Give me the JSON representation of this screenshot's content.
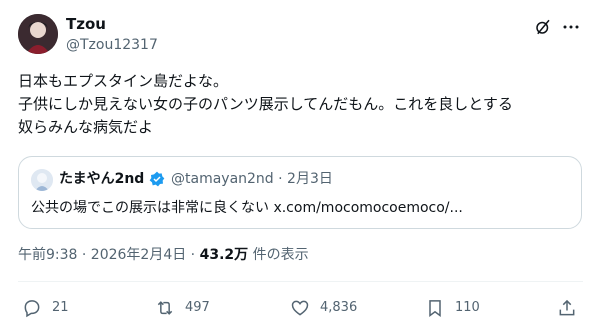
{
  "author": {
    "name": "Tzou",
    "handle": "@Tzou12317"
  },
  "tweet": {
    "lines": [
      "日本もエプスタイン島だよな。",
      "子供にしか見えない女の子のパンツ展示してんだもん。これを良しとする",
      "奴らみんな病気だよ"
    ]
  },
  "quote": {
    "name": "たまやん2nd",
    "meta": "@tamayan2nd · 2月3日",
    "text": "公共の場でこの展示は非常に良くない x.com/mocomocoemoco/..."
  },
  "meta": {
    "time": "午前9:38 · 2026年2月4日 · ",
    "views": "43.2万",
    "views_label": " 件の表示"
  },
  "actions": {
    "replies": "21",
    "reposts": "497",
    "likes": "4,836",
    "bookmarks": "110"
  },
  "icons": [
    "grok-icon",
    "more-icon",
    "reply-icon",
    "repost-icon",
    "like-icon",
    "bookmark-icon",
    "share-icon",
    "verified-icon"
  ],
  "colors": {
    "text": "#0f1419",
    "secondary": "#536471",
    "verified": "#1d9bf0",
    "border": "#cfd9de"
  }
}
